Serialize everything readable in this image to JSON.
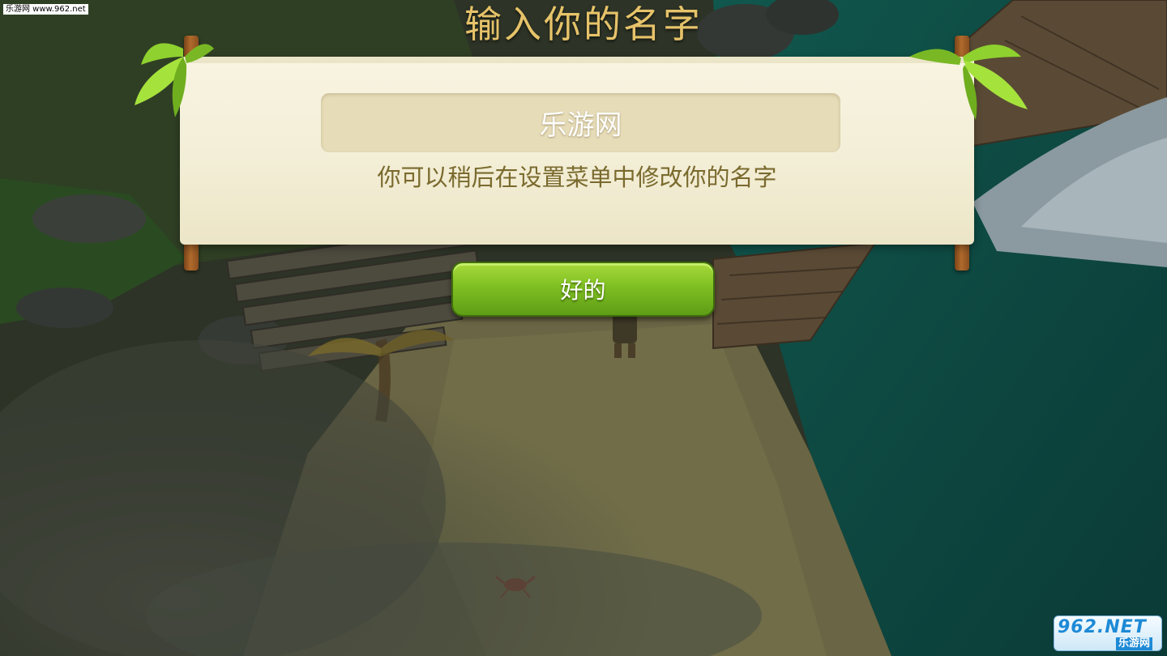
{
  "watermark_top": "乐游网 www.962.net",
  "title": "输入你的名字",
  "name_input": {
    "value": "乐游网"
  },
  "hint": "你可以稍后在设置菜单中修改你的名字",
  "ok_button": {
    "label": "好的"
  },
  "watermark_bottom": {
    "brand": "962.NET",
    "site": "乐游网"
  },
  "colors": {
    "title": "#e6c36a",
    "scroll_paper": "#f3eed6",
    "input_bg": "#e6dcb8",
    "hint_text": "#7a6a2e",
    "button_green": "#7fbf22",
    "water": "#0f4a42",
    "sand": "#6e6a4a"
  },
  "icons": [
    "palm-leaf-icon",
    "crab-icon"
  ]
}
